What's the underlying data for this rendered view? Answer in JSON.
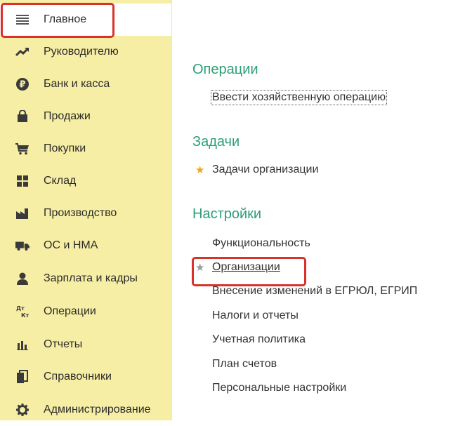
{
  "sidebar": {
    "items": [
      {
        "label": "Главное",
        "icon": "menu-icon"
      },
      {
        "label": "Руководителю",
        "icon": "trend-up-icon"
      },
      {
        "label": "Банк и касса",
        "icon": "ruble-icon"
      },
      {
        "label": "Продажи",
        "icon": "shopping-bag-icon"
      },
      {
        "label": "Покупки",
        "icon": "cart-icon"
      },
      {
        "label": "Склад",
        "icon": "warehouse-grid-icon"
      },
      {
        "label": "Производство",
        "icon": "factory-icon"
      },
      {
        "label": "ОС и НМА",
        "icon": "truck-icon"
      },
      {
        "label": "Зарплата и кадры",
        "icon": "person-icon"
      },
      {
        "label": "Операции",
        "icon": "dt-kt-icon",
        "icon_text_top": "Дт",
        "icon_text_bottom": "Кт"
      },
      {
        "label": "Отчеты",
        "icon": "bar-chart-icon"
      },
      {
        "label": "Справочники",
        "icon": "books-icon"
      },
      {
        "label": "Администрирование",
        "icon": "gear-icon"
      }
    ]
  },
  "main": {
    "sections": [
      {
        "title": "Операции",
        "items": [
          {
            "label": "Ввести хозяйственную операцию"
          }
        ]
      },
      {
        "title": "Задачи",
        "items": [
          {
            "label": "Задачи организации",
            "star": "★"
          }
        ]
      },
      {
        "title": "Настройки",
        "items": [
          {
            "label": "Функциональность"
          },
          {
            "label": "Организации",
            "star": "★"
          },
          {
            "label": "Внесение изменений в ЕГРЮЛ, ЕГРИП"
          },
          {
            "label": "Налоги и отчеты"
          },
          {
            "label": "Учетная политика"
          },
          {
            "label": "План счетов"
          },
          {
            "label": "Персональные настройки"
          }
        ]
      }
    ]
  },
  "colors": {
    "sidebar_bg": "#f7eea5",
    "section_title": "#2b9f74",
    "highlight": "#d9322b",
    "star_gold": "#f0a818",
    "star_gray": "#9a9a9a"
  }
}
